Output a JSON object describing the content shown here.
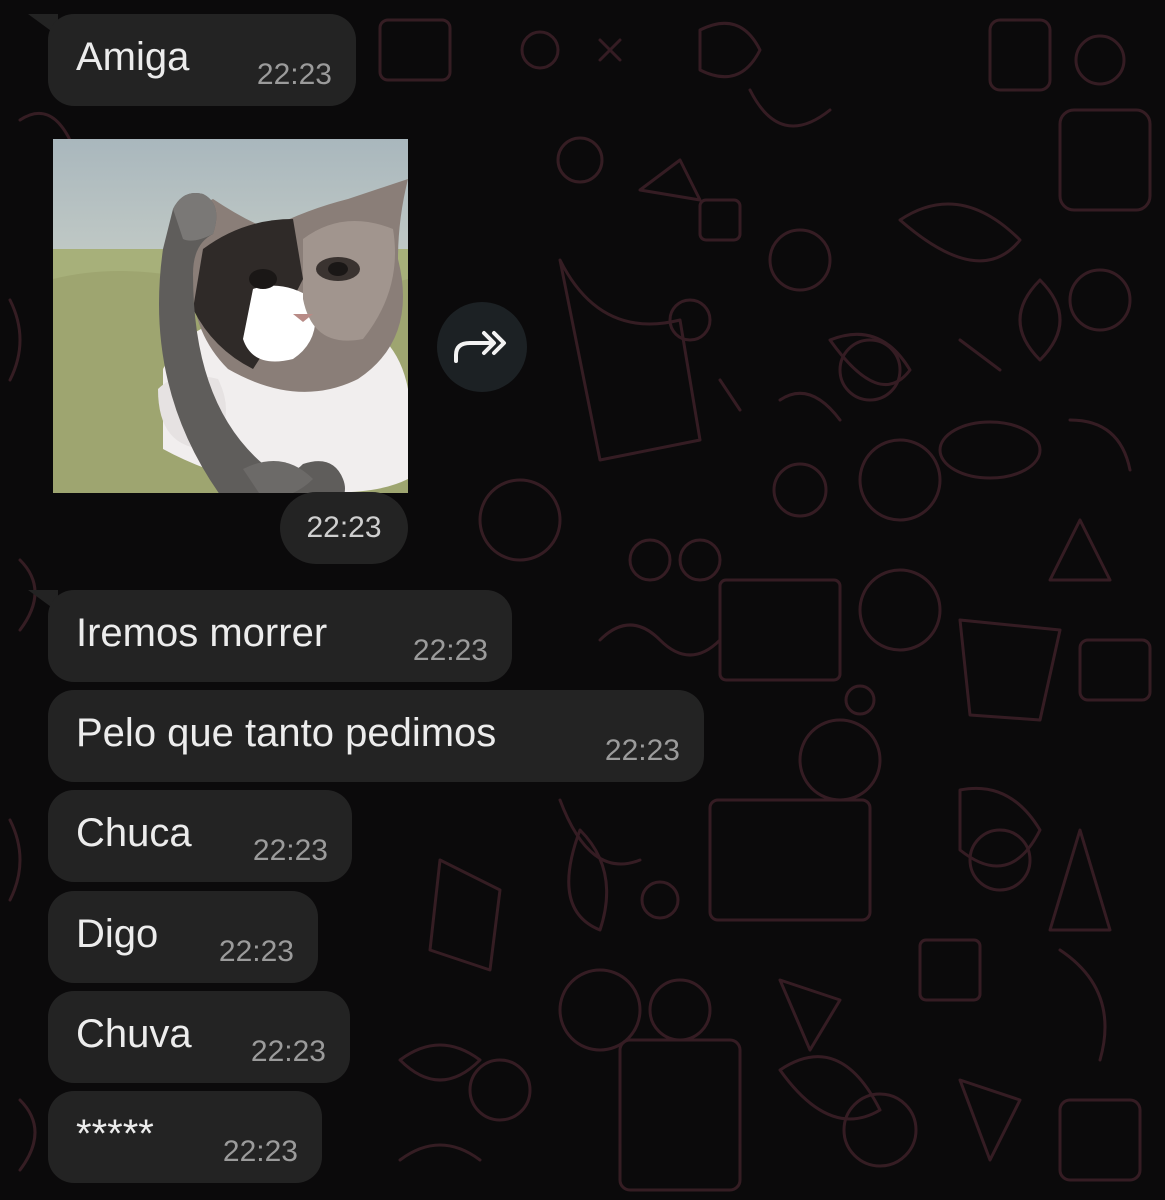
{
  "messages": [
    {
      "text": "Amiga",
      "time": "22:23"
    },
    {
      "text": "Iremos morrer",
      "time": "22:23"
    },
    {
      "text": "Pelo que tanto pedimos",
      "time": "22:23"
    },
    {
      "text": "Chuca",
      "time": "22:23"
    },
    {
      "text": "Digo",
      "time": "22:23"
    },
    {
      "text": "Chuva",
      "time": "22:23"
    },
    {
      "text": "*****",
      "time": "22:23"
    }
  ],
  "sticker": {
    "description_icon": "cat-phone-sticker",
    "time": "22:23"
  },
  "forward_button": {
    "icon": "forward-icon"
  },
  "colors": {
    "background": "#0b0a0b",
    "bubble": "#232323",
    "text": "#ececec",
    "time": "#9b9b9b",
    "pattern": "#3a1f26"
  }
}
